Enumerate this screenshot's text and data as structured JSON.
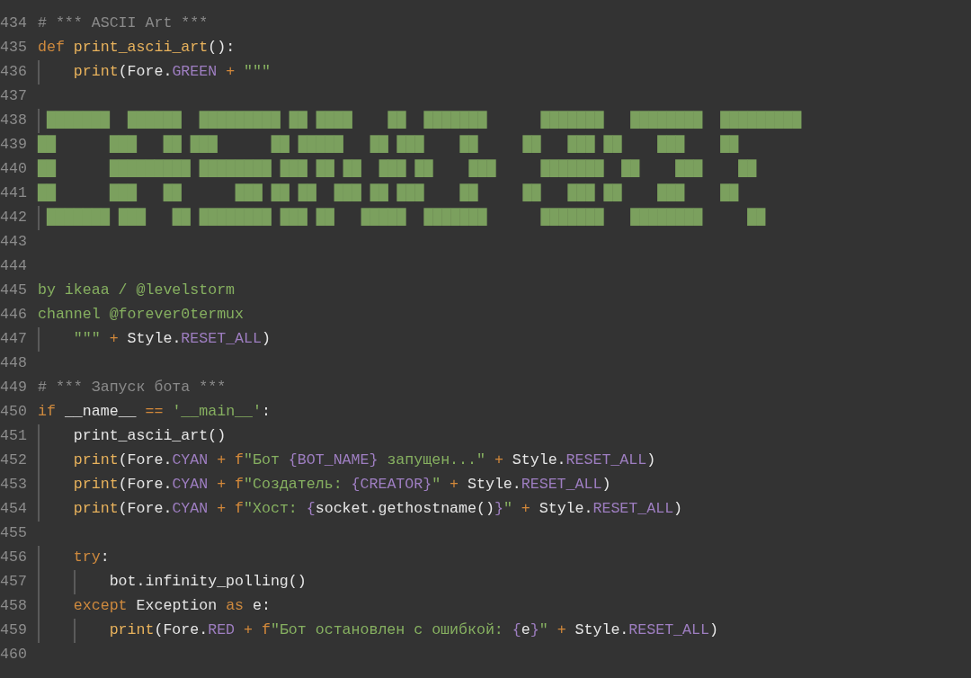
{
  "editor": {
    "lines": [
      {
        "number": "434",
        "tokens": [
          {
            "text": "# *** ASCII Art ***",
            "kind": "comment"
          }
        ]
      },
      {
        "number": "435",
        "tokens": [
          {
            "text": "def ",
            "kind": "keyword"
          },
          {
            "text": "print_ascii_art",
            "kind": "function"
          },
          {
            "text": "():",
            "kind": "plain"
          }
        ]
      },
      {
        "number": "436",
        "tokens": [
          {
            "text": "    print",
            "kind": "function"
          },
          {
            "text": "(Fore.",
            "kind": "plain"
          },
          {
            "text": "GREEN",
            "kind": "constant"
          },
          {
            "text": " + ",
            "kind": "operator"
          },
          {
            "text": "\"\"\"",
            "kind": "string"
          }
        ]
      },
      {
        "number": "437"
      },
      {
        "number": "438",
        "tokens": [
          {
            "text": " ███████  ██████  █████████ ██ ████    ██  ███████      ███████   ████████  █████████",
            "kind": "art"
          }
        ]
      },
      {
        "number": "439",
        "tokens": [
          {
            "text": "██      ███   ██ ███      ██ █████   ██ ███    ██     ██   ███ ██    ███    ██",
            "kind": "art"
          }
        ]
      },
      {
        "number": "440",
        "tokens": [
          {
            "text": "██      █████████ ████████ ███ ██ ██  ███ ██    ███     ███████  ██    ███    ██",
            "kind": "art"
          }
        ]
      },
      {
        "number": "441",
        "tokens": [
          {
            "text": "██      ███   ██      ███ ██ ██  ███ ██ ███    ██     ██   ███ ██    ███    ██",
            "kind": "art"
          }
        ]
      },
      {
        "number": "442",
        "tokens": [
          {
            "text": " ███████ ███   ██ ████████ ███ ██   █████  ███████      ███████   ████████     ██",
            "kind": "art"
          }
        ]
      },
      {
        "number": "443"
      },
      {
        "number": "444"
      },
      {
        "number": "445",
        "tokens": [
          {
            "text": "by ikeaa / @levelstorm",
            "kind": "string"
          }
        ]
      },
      {
        "number": "446",
        "tokens": [
          {
            "text": "channel @forever0termux",
            "kind": "string"
          }
        ]
      },
      {
        "number": "447",
        "tokens": [
          {
            "text": "    \"\"\"",
            "kind": "string"
          },
          {
            "text": " + ",
            "kind": "operator"
          },
          {
            "text": "Style.",
            "kind": "plain"
          },
          {
            "text": "RESET_ALL",
            "kind": "constant"
          },
          {
            "text": ")",
            "kind": "plain"
          }
        ]
      },
      {
        "number": "448"
      },
      {
        "number": "449",
        "tokens": [
          {
            "text": "# *** Запуск бота ***",
            "kind": "comment"
          }
        ]
      },
      {
        "number": "450",
        "tokens": [
          {
            "text": "if",
            "kind": "keyword"
          },
          {
            "text": " __name__ ",
            "kind": "plain"
          },
          {
            "text": "== ",
            "kind": "operator"
          },
          {
            "text": "'__main__'",
            "kind": "string"
          },
          {
            "text": ":",
            "kind": "plain"
          }
        ]
      },
      {
        "number": "451",
        "tokens": [
          {
            "text": "    print_ascii_art()",
            "kind": "plain"
          }
        ]
      },
      {
        "number": "452",
        "tokens": [
          {
            "text": "    print",
            "kind": "function"
          },
          {
            "text": "(Fore.",
            "kind": "plain"
          },
          {
            "text": "CYAN",
            "kind": "constant"
          },
          {
            "text": " + f",
            "kind": "operator"
          },
          {
            "text": "\"Бот ",
            "kind": "string"
          },
          {
            "text": "{BOT_NAME}",
            "kind": "constant"
          },
          {
            "text": " запущен...\"",
            "kind": "string"
          },
          {
            "text": " + ",
            "kind": "operator"
          },
          {
            "text": "Style.",
            "kind": "plain"
          },
          {
            "text": "RESET_ALL",
            "kind": "constant"
          },
          {
            "text": ")",
            "kind": "plain"
          }
        ]
      },
      {
        "number": "453",
        "tokens": [
          {
            "text": "    print",
            "kind": "function"
          },
          {
            "text": "(Fore.",
            "kind": "plain"
          },
          {
            "text": "CYAN",
            "kind": "constant"
          },
          {
            "text": " + f",
            "kind": "operator"
          },
          {
            "text": "\"Создатель: ",
            "kind": "string"
          },
          {
            "text": "{CREATOR}",
            "kind": "constant"
          },
          {
            "text": "\"",
            "kind": "string"
          },
          {
            "text": " + ",
            "kind": "operator"
          },
          {
            "text": "Style.",
            "kind": "plain"
          },
          {
            "text": "RESET_ALL",
            "kind": "constant"
          },
          {
            "text": ")",
            "kind": "plain"
          }
        ]
      },
      {
        "number": "454",
        "tokens": [
          {
            "text": "    print",
            "kind": "function"
          },
          {
            "text": "(Fore.",
            "kind": "plain"
          },
          {
            "text": "CYAN",
            "kind": "constant"
          },
          {
            "text": " + f",
            "kind": "operator"
          },
          {
            "text": "\"Хост: ",
            "kind": "string"
          },
          {
            "text": "{",
            "kind": "constant"
          },
          {
            "text": "socket.gethostname()",
            "kind": "plain"
          },
          {
            "text": "}",
            "kind": "constant"
          },
          {
            "text": "\"",
            "kind": "string"
          },
          {
            "text": " + ",
            "kind": "operator"
          },
          {
            "text": "Style.",
            "kind": "plain"
          },
          {
            "text": "RESET_ALL",
            "kind": "constant"
          },
          {
            "text": ")",
            "kind": "plain"
          }
        ]
      },
      {
        "number": "455"
      },
      {
        "number": "456",
        "tokens": [
          {
            "text": "    try",
            "kind": "keyword"
          },
          {
            "text": ":",
            "kind": "plain"
          }
        ]
      },
      {
        "number": "457",
        "tokens": [
          {
            "text": "        bot.infinity_polling()",
            "kind": "plain"
          }
        ]
      },
      {
        "number": "458",
        "tokens": [
          {
            "text": "    except",
            "kind": "keyword"
          },
          {
            "text": " Exception ",
            "kind": "plain"
          },
          {
            "text": "as",
            "kind": "keyword"
          },
          {
            "text": " e:",
            "kind": "plain"
          }
        ]
      },
      {
        "number": "459",
        "tokens": [
          {
            "text": "        print",
            "kind": "function"
          },
          {
            "text": "(Fore.",
            "kind": "plain"
          },
          {
            "text": "RED",
            "kind": "constant"
          },
          {
            "text": " + f",
            "kind": "operator"
          },
          {
            "text": "\"Бот остановлен с ошибкой: ",
            "kind": "string"
          },
          {
            "text": "{",
            "kind": "constant"
          },
          {
            "text": "e",
            "kind": "plain"
          },
          {
            "text": "}",
            "kind": "constant"
          },
          {
            "text": "\"",
            "kind": "string"
          },
          {
            "text": " + ",
            "kind": "operator"
          },
          {
            "text": "Style.",
            "kind": "plain"
          },
          {
            "text": "RESET_ALL",
            "kind": "constant"
          },
          {
            "text": ")",
            "kind": "plain"
          }
        ]
      },
      {
        "number": "460"
      }
    ]
  }
}
